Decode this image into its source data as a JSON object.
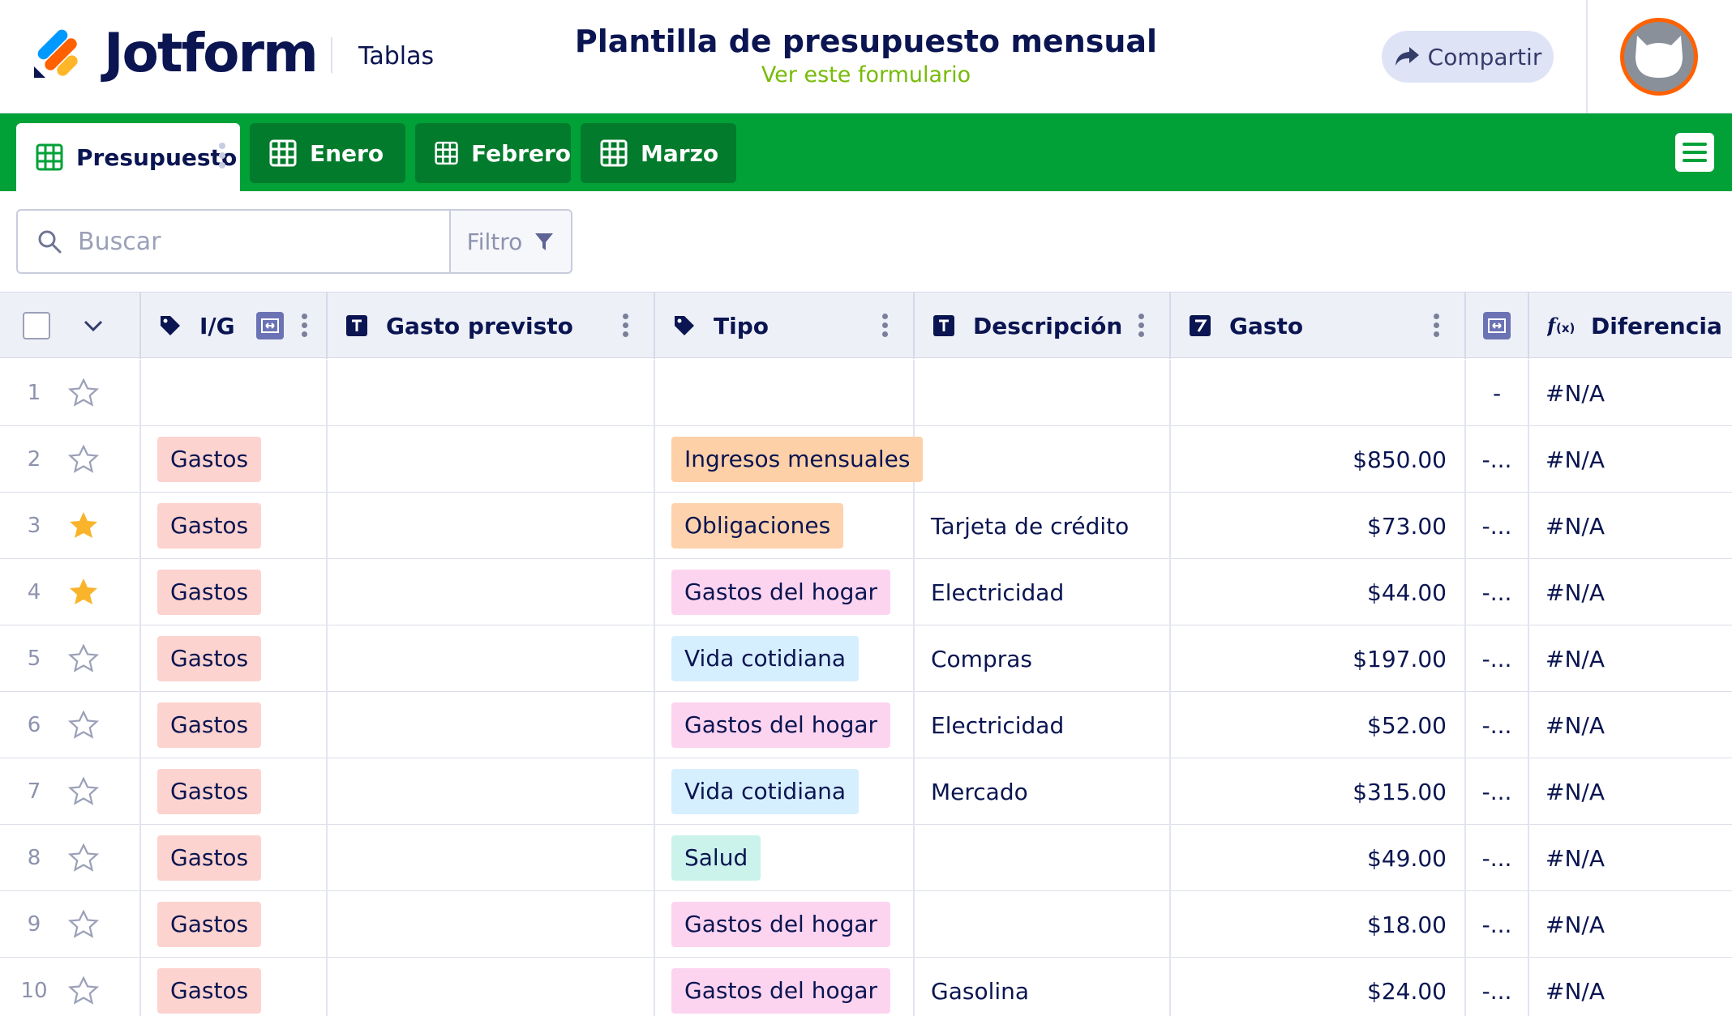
{
  "header": {
    "brand": "Jotform",
    "section": "Tablas",
    "title": "Plantilla de presupuesto mensual",
    "subtitle": "Ver este formulario",
    "share_label": "Compartir"
  },
  "tabs": [
    {
      "label": "Presupuesto",
      "active": true
    },
    {
      "label": "Enero",
      "active": false
    },
    {
      "label": "Febrero",
      "active": false
    },
    {
      "label": "Marzo",
      "active": false
    }
  ],
  "search": {
    "placeholder": "Buscar",
    "filter_label": "Filtro"
  },
  "table": {
    "columns": {
      "ig": "I/G",
      "gasto_previsto": "Gasto previsto",
      "tipo": "Tipo",
      "descripcion": "Descripción",
      "gasto": "Gasto",
      "diferencia": "Diferencia"
    },
    "rows": [
      {
        "n": "1",
        "starred": false,
        "ig": "",
        "tipo": "",
        "descripcion": "",
        "gasto": "",
        "calc": "-",
        "diferencia": "#N/A"
      },
      {
        "n": "2",
        "starred": false,
        "ig": "Gastos",
        "tipo": "Ingresos mensuales",
        "descripcion": "",
        "gasto": "$850.00",
        "calc": "-...",
        "diferencia": "#N/A"
      },
      {
        "n": "3",
        "starred": true,
        "ig": "Gastos",
        "tipo": "Obligaciones",
        "descripcion": "Tarjeta de crédito",
        "gasto": "$73.00",
        "calc": "-...",
        "diferencia": "#N/A"
      },
      {
        "n": "4",
        "starred": true,
        "ig": "Gastos",
        "tipo": "Gastos del hogar",
        "descripcion": "Electricidad",
        "gasto": "$44.00",
        "calc": "-...",
        "diferencia": "#N/A"
      },
      {
        "n": "5",
        "starred": false,
        "ig": "Gastos",
        "tipo": "Vida cotidiana",
        "descripcion": "Compras",
        "gasto": "$197.00",
        "calc": "-...",
        "diferencia": "#N/A"
      },
      {
        "n": "6",
        "starred": false,
        "ig": "Gastos",
        "tipo": "Gastos del hogar",
        "descripcion": "Electricidad",
        "gasto": "$52.00",
        "calc": "-...",
        "diferencia": "#N/A"
      },
      {
        "n": "7",
        "starred": false,
        "ig": "Gastos",
        "tipo": "Vida cotidiana",
        "descripcion": "Mercado",
        "gasto": "$315.00",
        "calc": "-...",
        "diferencia": "#N/A"
      },
      {
        "n": "8",
        "starred": false,
        "ig": "Gastos",
        "tipo": "Salud",
        "descripcion": "",
        "gasto": "$49.00",
        "calc": "-...",
        "diferencia": "#N/A"
      },
      {
        "n": "9",
        "starred": false,
        "ig": "Gastos",
        "tipo": "Gastos del hogar",
        "descripcion": "",
        "gasto": "$18.00",
        "calc": "-...",
        "diferencia": "#N/A"
      },
      {
        "n": "10",
        "starred": false,
        "ig": "Gastos",
        "tipo": "Gastos del hogar",
        "descripcion": "Gasolina",
        "gasto": "$24.00",
        "calc": "-...",
        "diferencia": "#N/A"
      }
    ]
  },
  "colors": {
    "tab_bar": "#01a138",
    "tab_inactive": "#027b2c",
    "star_active": "#f9b42c",
    "tag_gastos": "#fdd3cf",
    "tag_ingresos": "#fed0a8",
    "tag_obligaciones": "#fdd2ad",
    "tag_hogar": "#fdd4f0",
    "tag_vida": "#d6efff",
    "tag_salud": "#cbf3ec"
  }
}
